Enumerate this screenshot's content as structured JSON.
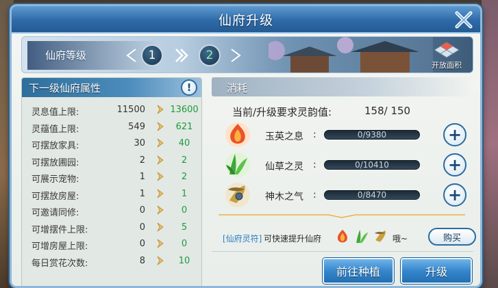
{
  "window": {
    "title": "仙府升级"
  },
  "banner": {
    "label": "仙府等级",
    "current_level": "1",
    "next_level": "2",
    "open_area_label": "开放面积"
  },
  "attributes": {
    "header": "下一级仙府属性",
    "rows": [
      {
        "name": "灵息值上限:",
        "current": "11500",
        "next": "13600"
      },
      {
        "name": "灵蕴值上限:",
        "current": "549",
        "next": "621"
      },
      {
        "name": "可摆放家具:",
        "current": "30",
        "next": "40"
      },
      {
        "name": "可摆放圃园:",
        "current": "2",
        "next": "2"
      },
      {
        "name": "可展示宠物:",
        "current": "1",
        "next": "2"
      },
      {
        "name": "可摆放房屋:",
        "current": "1",
        "next": "1"
      },
      {
        "name": "可邀请同修:",
        "current": "0",
        "next": "0"
      },
      {
        "name": "可增摆件上限:",
        "current": "0",
        "next": "5"
      },
      {
        "name": "可增房屋上限:",
        "current": "0",
        "next": "0"
      },
      {
        "name": "每日赏花次数:",
        "current": "8",
        "next": "10"
      }
    ]
  },
  "cost": {
    "header": "消耗",
    "requirement_label": "当前/升级要求灵韵值:",
    "requirement_value": "158/ 150",
    "resources": [
      {
        "name": "玉英之息",
        "progress": "0/9380",
        "icon": "flame-flower-icon",
        "color": "#e8542a"
      },
      {
        "name": "仙草之灵",
        "progress": "0/10410",
        "icon": "herb-leaf-icon",
        "color": "#3fa83a"
      },
      {
        "name": "神木之气",
        "progress": "0/8470",
        "icon": "wood-relic-icon",
        "color": "#c9a040"
      }
    ],
    "colon": ":"
  },
  "tip": {
    "link": "[仙府灵符]",
    "text": "可快速提升仙府",
    "suffix": "哦~",
    "buy_label": "购买"
  },
  "actions": {
    "plant_label": "前往种植",
    "upgrade_label": "升级"
  }
}
